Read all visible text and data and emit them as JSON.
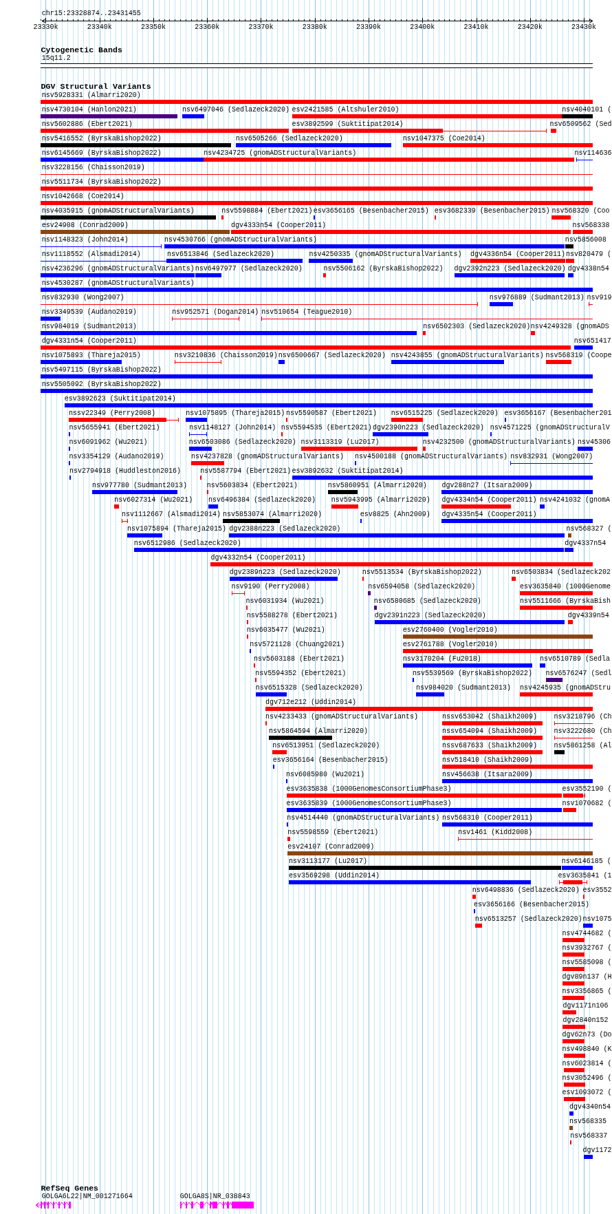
{
  "ruler": {
    "location": "chr15:23328874..23431455",
    "ticks": [
      "23330k",
      "23340k",
      "23350k",
      "23360k",
      "23370k",
      "23380k",
      "23390k",
      "23400k",
      "23410k",
      "23420k",
      "23430k"
    ]
  },
  "cytogenetic_bands": {
    "title": "Cytogenetic Bands",
    "bands": [
      {
        "label": "15q11.2"
      }
    ]
  },
  "dgv_structural_variants": {
    "title": "DGV Structural Variants",
    "lanes": [
      {
        "features": [
          {
            "label": "nsv5928331 (Almarri2020)",
            "color": "#ff0000",
            "kind": "bar"
          }
        ]
      },
      {
        "features": [
          {
            "label": "nsv4730104 (Hanlon2021)",
            "color": "#4b0082",
            "kind": "bar"
          },
          {
            "label": "nsv6497046 (Sedlazeck2020)",
            "color": "#0000ff",
            "kind": "bar"
          },
          {
            "label": "esv2421585 (Altshuler2010)",
            "color": "#ff0000",
            "kind": "bar"
          },
          {
            "label": "nsv4040101 (",
            "color": "#000000",
            "kind": "bar"
          }
        ]
      },
      {
        "features": [
          {
            "label": "nsv5602886 (Ebert2021)",
            "color": "#ff0000",
            "kind": "bar"
          },
          {
            "label": "esv3892599 (Suktitipat2014)",
            "color": "#ff0000",
            "kind": "mixed"
          },
          {
            "label": "nsv6509562 (Sed",
            "color": "#ff0000",
            "kind": "bar"
          }
        ]
      },
      {
        "features": [
          {
            "label": "nsv5416552 (ByrskaBishop2022)",
            "color": "#000000",
            "kind": "bar"
          },
          {
            "label": "nsv6505266 (Sedlazeck2020)",
            "color": "#0000ff",
            "kind": "bar"
          },
          {
            "label": "nsv1047375 (Coe2014)",
            "color": "#ff0000",
            "kind": "bar"
          }
        ]
      },
      {
        "features": [
          {
            "label": "nsv6145669 (ByrskaBishop2022)",
            "color": "#0000ff",
            "kind": "bar"
          },
          {
            "label": "nsv4234725 (gnomADStructuralVariants)",
            "color": "#ff0000",
            "kind": "bar"
          },
          {
            "label": "nsv114636",
            "color": "#0000ff",
            "kind": "line"
          }
        ]
      },
      {
        "features": [
          {
            "label": "nsv3228156 (Chaisson2019)",
            "color": "#ff0000",
            "kind": "line"
          }
        ]
      },
      {
        "features": [
          {
            "label": "nsv5511734 (ByrskaBishop2022)",
            "color": "#ff0000",
            "kind": "bar"
          }
        ]
      },
      {
        "features": [
          {
            "label": "nsv1042668 (Coe2014)",
            "color": "#ff0000",
            "kind": "bar"
          }
        ]
      },
      {
        "features": [
          {
            "label": "nsv4035915 (gnomADStructuralVariants)",
            "color": "#000000",
            "kind": "bar"
          },
          {
            "label": "nsv5598884 (Ebert2021)",
            "color": "#ff0000",
            "kind": "bar"
          },
          {
            "label": "esv3656165 (Besenbacher2015)",
            "color": "#0000ff",
            "kind": "bar"
          },
          {
            "label": "esv3682339 (Besenbacher2015)",
            "color": "#ff0000",
            "kind": "bar"
          },
          {
            "label": "nsv568320 (Coo",
            "color": "#ff0000",
            "kind": "bar"
          }
        ]
      },
      {
        "features": [
          {
            "label": "esv24908 (Conrad2009)",
            "color": "#8b4513",
            "kind": "bar"
          },
          {
            "label": "dgv4333n54 (Cooper2011)",
            "color": "#ff0000",
            "kind": "bar"
          },
          {
            "label": "nsv568338",
            "color": "#ff0000",
            "kind": "bar"
          }
        ]
      },
      {
        "features": [
          {
            "label": "nsv1148323 (John2014)",
            "color": "#0000ff",
            "kind": "line"
          },
          {
            "label": "nsv4530766 (gnomADStructuralVariants)",
            "color": "#0000ff",
            "kind": "bar"
          },
          {
            "label": "nsv5856008",
            "color": "#000000",
            "kind": "bar"
          }
        ]
      },
      {
        "features": [
          {
            "label": "nsv1118552 (Alsmadi2014)",
            "color": "#0000ff",
            "kind": "line"
          },
          {
            "label": "nsv6513846 (Sedlazeck2020)",
            "color": "#0000ff",
            "kind": "bar"
          },
          {
            "label": "nsv4250335 (gnomADStructuralVariants)",
            "color": "#0000ff",
            "kind": "bar"
          },
          {
            "label": "dgv4336n54 (Cooper2011)",
            "color": "#ff0000",
            "kind": "bar"
          },
          {
            "label": "nsv820479 (",
            "color": "#ff0000",
            "kind": "bar"
          }
        ]
      },
      {
        "features": [
          {
            "label": "nsv4236296 (gnomADStructuralVariants)",
            "color": "#0000ff",
            "kind": "bar"
          },
          {
            "label": "nsv6497977 (Sedlazeck2020)",
            "color": "#0000ff",
            "kind": "bar"
          },
          {
            "label": "nsv5506162 (ByrskaBishop2022)",
            "color": "#ff0000",
            "kind": "bar"
          },
          {
            "label": "dgv2392n223 (Sedlazeck2020)",
            "color": "#0000ff",
            "kind": "bar"
          },
          {
            "label": "dgv4338n54",
            "color": "#0000ff",
            "kind": "bar"
          }
        ]
      },
      {
        "features": [
          {
            "label": "nsv4530287 (gnomADStructuralVariants)",
            "color": "#0000ff",
            "kind": "bar"
          }
        ]
      },
      {
        "features": [
          {
            "label": "nsv832930 (Wong2007)",
            "color": "#ff0000",
            "kind": "line"
          },
          {
            "label": "nsv976889 (Sudmant2013)",
            "color": "#0000ff",
            "kind": "bar"
          },
          {
            "label": "nsv919",
            "color": "#ff0000",
            "kind": "line"
          }
        ]
      },
      {
        "features": [
          {
            "label": "nsv3349539 (Audano2019)",
            "color": "#0000ff",
            "kind": "bar"
          },
          {
            "label": "nsv952571 (Dogan2014)",
            "color": "#ff0000",
            "kind": "line"
          },
          {
            "label": "nsv510654 (Teague2010)",
            "color": "#ff0000",
            "kind": "line"
          }
        ]
      },
      {
        "features": [
          {
            "label": "nsv984019 (Sudmant2013)",
            "color": "#0000ff",
            "kind": "bar"
          },
          {
            "label": "nsv6502303 (Sedlazeck2020)",
            "color": "#ff0000",
            "kind": "bar"
          },
          {
            "label": "nsv4249328 (gnomADS",
            "color": "#ff0000",
            "kind": "bar"
          }
        ]
      },
      {
        "features": [
          {
            "label": "dgv4331n54 (Cooper2011)",
            "color": "#ff0000",
            "kind": "bar"
          },
          {
            "label": "nsv651417",
            "color": "#0000ff",
            "kind": "bar"
          }
        ]
      },
      {
        "features": [
          {
            "label": "nsv1075893 (Thareja2015)",
            "color": "#0000ff",
            "kind": "bar"
          },
          {
            "label": "nsv3210836 (Chaisson2019)",
            "color": "#ff0000",
            "kind": "line"
          },
          {
            "label": "nsv6500667 (Sedlazeck2020)",
            "color": "#0000ff",
            "kind": "bar"
          },
          {
            "label": "nsv4243855 (gnomADStructuralVariants)",
            "color": "#0000ff",
            "kind": "bar"
          },
          {
            "label": "nsv568319 (Coope",
            "color": "#ff0000",
            "kind": "bar"
          }
        ]
      },
      {
        "features": [
          {
            "label": "nsv5497115 (ByrskaBishop2022)",
            "color": "#0000ff",
            "kind": "bar"
          }
        ]
      },
      {
        "features": [
          {
            "label": "nsv5505092 (ByrskaBishop2022)",
            "color": "#0000ff",
            "kind": "bar"
          }
        ]
      },
      {
        "features": [
          {
            "label": "esv3892623 (Suktitipat2014)",
            "color": "#0000ff",
            "kind": "bar"
          }
        ]
      },
      {
        "features": [
          {
            "label": "nssv22349 (Perry2008)",
            "color": "#ff0000",
            "kind": "mixed"
          },
          {
            "label": "nsv1075895 (Thareja2015)",
            "color": "#0000ff",
            "kind": "bar"
          },
          {
            "label": "nsv5590587 (Ebert2021)",
            "color": "#ff0000",
            "kind": "bar"
          },
          {
            "label": "nsv6515225 (Sedlazeck2020)",
            "color": "#ff0000",
            "kind": "bar"
          },
          {
            "label": "esv3656167 (Besenbacher201",
            "color": "#0000ff",
            "kind": "bar"
          }
        ]
      },
      {
        "features": [
          {
            "label": "nsv5655941 (Ebert2021)",
            "color": "#0000ff",
            "kind": "bar"
          },
          {
            "label": "nsv1148127 (John2014)",
            "color": "#0000ff",
            "kind": "line"
          },
          {
            "label": "nsv5594535 (Ebert2021)",
            "color": "#ff0000",
            "kind": "bar"
          },
          {
            "label": "dgv2390n223 (Sedlazeck2020)",
            "color": "#0000ff",
            "kind": "bar"
          },
          {
            "label": "nsv4571225 (gnomADStructuralV",
            "color": "#0000ff",
            "kind": "bar"
          }
        ]
      },
      {
        "features": [
          {
            "label": "nsv6091962 (Wu2021)",
            "color": "#0000ff",
            "kind": "bar"
          },
          {
            "label": "nsv6503086 (Sedlazeck2020)",
            "color": "#0000ff",
            "kind": "bar"
          },
          {
            "label": "nsv3113319 (Lu2017)",
            "color": "#ff0000",
            "kind": "bar"
          },
          {
            "label": "nsv4232500 (gnomADStructuralVariants)",
            "color": "#ff0000",
            "kind": "bar"
          },
          {
            "label": "nsv45306",
            "color": "#0000ff",
            "kind": "bar"
          }
        ]
      },
      {
        "features": [
          {
            "label": "nsv3354129 (Audano2019)",
            "color": "#0000ff",
            "kind": "bar"
          },
          {
            "label": "nsv4237828 (gnomADStructuralVariants)",
            "color": "#ff0000",
            "kind": "bar"
          },
          {
            "label": "nsv4500188 (gnomADStructuralVariants)",
            "color": "#0000ff",
            "kind": "bar"
          },
          {
            "label": "nsv832931 (Wong2007)",
            "color": "#0000ff",
            "kind": "line"
          }
        ]
      },
      {
        "features": [
          {
            "label": "nsv2794918 (Huddleston2016)",
            "color": "#0000ff",
            "kind": "bar"
          },
          {
            "label": "nsv5587794 (Ebert2021)",
            "color": "#ff0000",
            "kind": "bar"
          },
          {
            "label": "esv3892632 (Suktitipat2014)",
            "color": "#0000ff",
            "kind": "bar"
          }
        ]
      },
      {
        "features": [
          {
            "label": "nsv977780 (Sudmant2013)",
            "color": "#0000ff",
            "kind": "bar"
          },
          {
            "label": "nsv5603834 (Ebert2021)",
            "color": "#ff0000",
            "kind": "bar"
          },
          {
            "label": "nsv5860951 (Almarri2020)",
            "color": "#000000",
            "kind": "bar"
          },
          {
            "label": "dgv288n27 (Itsara2009)",
            "color": "#0000ff",
            "kind": "bar"
          }
        ]
      },
      {
        "features": [
          {
            "label": "nsv6027314 (Wu2021)",
            "color": "#ff0000",
            "kind": "bar"
          },
          {
            "label": "nsv6496384 (Sedlazeck2020)",
            "color": "#0000ff",
            "kind": "bar"
          },
          {
            "label": "nsv5943995 (Almarri2020)",
            "color": "#ff0000",
            "kind": "bar"
          },
          {
            "label": "dgv4334n54 (Cooper2011)",
            "color": "#ff0000",
            "kind": "bar"
          },
          {
            "label": "nsv4241032 (gnomA",
            "color": "#0000ff",
            "kind": "bar"
          }
        ]
      },
      {
        "features": [
          {
            "label": "nsv1112667 (Alsmadi2014)",
            "color": "#ff0000",
            "kind": "line"
          },
          {
            "label": "nsv5853074 (Almarri2020)",
            "color": "#000000",
            "kind": "bar"
          },
          {
            "label": "esv8825 (Ahn2009)",
            "color": "#0000ff",
            "kind": "bar"
          },
          {
            "label": "dgv4335n54 (Cooper2011)",
            "color": "#0000ff",
            "kind": "bar"
          }
        ]
      },
      {
        "features": [
          {
            "label": "nsv1075894 (Thareja2015)",
            "color": "#0000ff",
            "kind": "bar"
          },
          {
            "label": "dgv2388n223 (Sedlazeck2020)",
            "color": "#0000ff",
            "kind": "bar"
          },
          {
            "label": "nsv568327 (",
            "color": "#8b4513",
            "kind": "bar"
          }
        ]
      },
      {
        "features": [
          {
            "label": "nsv6512986 (Sedlazeck2020)",
            "color": "#0000ff",
            "kind": "bar"
          },
          {
            "label": "dgv4337n54",
            "color": "#0000ff",
            "kind": "bar"
          }
        ]
      },
      {
        "features": [
          {
            "label": "dgv4332n54 (Cooper2011)",
            "color": "#ff0000",
            "kind": "bar"
          }
        ]
      },
      {
        "features": [
          {
            "label": "dgv2389n223 (Sedlazeck2020)",
            "color": "#0000ff",
            "kind": "bar"
          },
          {
            "label": "nsv5513534 (ByrskaBishop2022)",
            "color": "#ff0000",
            "kind": "bar"
          },
          {
            "label": "nsv6503834 (Sedlazeck202",
            "color": "#ff0000",
            "kind": "bar"
          }
        ]
      },
      {
        "features": [
          {
            "label": "nsv9190 (Perry2008)",
            "color": "#ff0000",
            "kind": "line"
          },
          {
            "label": "nsv6594058 (Sedlazeck2020)",
            "color": "#4b0082",
            "kind": "bar"
          },
          {
            "label": "esv3635840 (1000Genome",
            "color": "#ff0000",
            "kind": "bar"
          }
        ]
      },
      {
        "features": [
          {
            "label": "nsv6031934 (Wu2021)",
            "color": "#ff0000",
            "kind": "bar"
          },
          {
            "label": "nsv6580685 (Sedlazeck2020)",
            "color": "#4b0082",
            "kind": "bar"
          },
          {
            "label": "nsv5511666 (ByrskaBish",
            "color": "#ff0000",
            "kind": "bar"
          }
        ]
      },
      {
        "features": [
          {
            "label": "nsv5588278 (Ebert2021)",
            "color": "#ff0000",
            "kind": "bar"
          },
          {
            "label": "dgv2391n223 (Sedlazeck2020)",
            "color": "#0000ff",
            "kind": "bar"
          },
          {
            "label": "dgv4339n54",
            "color": "#ff0000",
            "kind": "bar"
          }
        ]
      },
      {
        "features": [
          {
            "label": "nsv6035477 (Wu2021)",
            "color": "#ff0000",
            "kind": "bar"
          },
          {
            "label": "esv2760400 (Vogler2010)",
            "color": "#8b4513",
            "kind": "bar"
          }
        ]
      },
      {
        "features": [
          {
            "label": "nsv5721128 (Chuang2021)",
            "color": "#0000ff",
            "kind": "bar"
          },
          {
            "label": "esv2761788 (Vogler2010)",
            "color": "#ff0000",
            "kind": "bar"
          }
        ]
      },
      {
        "features": [
          {
            "label": "nsv5603188 (Ebert2021)",
            "color": "#ff0000",
            "kind": "bar"
          },
          {
            "label": "nsv3170204 (Fu2018)",
            "color": "#0000ff",
            "kind": "bar"
          },
          {
            "label": "nsv6510789 (Sedla",
            "color": "#0000ff",
            "kind": "bar"
          }
        ]
      },
      {
        "features": [
          {
            "label": "nsv5594352 (Ebert2021)",
            "color": "#ff0000",
            "kind": "bar"
          },
          {
            "label": "nsv5539569 (ByrskaBishop2022)",
            "color": "#0000ff",
            "kind": "bar"
          },
          {
            "label": "nsv6576247 (Sedl",
            "color": "#4b0082",
            "kind": "bar"
          }
        ]
      },
      {
        "features": [
          {
            "label": "nsv6515328 (Sedlazeck2020)",
            "color": "#0000ff",
            "kind": "bar"
          },
          {
            "label": "nsv984020 (Sudmant2013)",
            "color": "#0000ff",
            "kind": "bar"
          },
          {
            "label": "nsv4245935 (gnomADStru",
            "color": "#ff0000",
            "kind": "bar"
          }
        ]
      },
      {
        "features": [
          {
            "label": "dgv712e212 (Uddin2014)",
            "color": "#ff0000",
            "kind": "bar"
          }
        ]
      },
      {
        "features": [
          {
            "label": "nsv4233433 (gnomADStructuralVariants)",
            "color": "#ff0000",
            "kind": "bar"
          },
          {
            "label": "nssv653042 (Shaikh2009)",
            "color": "#ff0000",
            "kind": "bar"
          },
          {
            "label": "nsv3218796 (Ch",
            "color": "#ff0000",
            "kind": "line"
          }
        ]
      },
      {
        "features": [
          {
            "label": "nsv5864594 (Almarri2020)",
            "color": "#000000",
            "kind": "bar"
          },
          {
            "label": "nssv654094 (Shaikh2009)",
            "color": "#ff0000",
            "kind": "bar"
          },
          {
            "label": "nsv3222680 (Ch",
            "color": "#ff0000",
            "kind": "line"
          }
        ]
      },
      {
        "features": [
          {
            "label": "nsv6513951 (Sedlazeck2020)",
            "color": "#ff0000",
            "kind": "bar"
          },
          {
            "label": "nssv687633 (Shaikh2009)",
            "color": "#ff0000",
            "kind": "bar"
          },
          {
            "label": "nsv5861258 (Al",
            "color": "#000000",
            "kind": "bar"
          }
        ]
      },
      {
        "features": [
          {
            "label": "esv3656164 (Besenbacher2015)",
            "color": "#0000ff",
            "kind": "bar"
          },
          {
            "label": "nsv518410 (Shaikh2009)",
            "color": "#ff0000",
            "kind": "bar"
          }
        ]
      },
      {
        "features": [
          {
            "label": "nsv6085980 (Wu2021)",
            "color": "#0000ff",
            "kind": "bar"
          },
          {
            "label": "nsv456638 (Itsara2009)",
            "color": "#0000ff",
            "kind": "bar"
          }
        ]
      },
      {
        "features": [
          {
            "label": "esv3635838 (1000GenomesConsortiumPhase3)",
            "color": "#ff0000",
            "kind": "bar"
          },
          {
            "label": "esv3552190 (",
            "color": "#ff0000",
            "kind": "mixed"
          }
        ]
      },
      {
        "features": [
          {
            "label": "esv3635839 (1000GenomesConsortiumPhase3)",
            "color": "#0000ff",
            "kind": "bar"
          },
          {
            "label": "nsv1070682 (",
            "color": "#ff0000",
            "kind": "bar"
          }
        ]
      },
      {
        "features": [
          {
            "label": "nsv4514440 (gnomADStructuralVariants)",
            "color": "#0000ff",
            "kind": "bar"
          },
          {
            "label": "nsv568310 (Cooper2011)",
            "color": "#0000ff",
            "kind": "bar"
          }
        ]
      },
      {
        "features": [
          {
            "label": "nsv5598559 (Ebert2021)",
            "color": "#ff0000",
            "kind": "bar"
          },
          {
            "label": "nsv1461 (Kidd2008)",
            "color": "#ff0000",
            "kind": "line"
          }
        ]
      },
      {
        "features": [
          {
            "label": "esv24107 (Conrad2009)",
            "color": "#8b4513",
            "kind": "bar"
          }
        ]
      },
      {
        "features": [
          {
            "label": "nsv3113177 (Lu2017)",
            "color": "#000000",
            "kind": "bar"
          },
          {
            "label": "nsv6146185 (",
            "color": "#0000ff",
            "kind": "bar"
          }
        ]
      },
      {
        "features": [
          {
            "label": "esv3569298 (Uddin2014)",
            "color": "#0000ff",
            "kind": "bar"
          },
          {
            "label": "esv3635841 (1",
            "color": "#ff0000",
            "kind": "mixed"
          }
        ]
      },
      {
        "features": [
          {
            "label": "nsv6498836 (Sedlazeck2020)",
            "color": "#ff0000",
            "kind": "bar"
          },
          {
            "label": "esv3552",
            "color": "#ff0000",
            "kind": "bar"
          }
        ]
      },
      {
        "features": [
          {
            "label": "esv3656166 (Besenbacher2015)",
            "color": "#0000ff",
            "kind": "bar"
          }
        ]
      },
      {
        "features": [
          {
            "label": "nsv6513257 (Sedlazeck2020)",
            "color": "#ff0000",
            "kind": "bar"
          },
          {
            "label": "nsv1075",
            "color": "#0000ff",
            "kind": "bar"
          }
        ]
      },
      {
        "features": [
          {
            "label": "nsv4744682 (",
            "color": "#ff0000",
            "kind": "bar"
          }
        ]
      },
      {
        "features": [
          {
            "label": "nsv3932767 (",
            "color": "#ff0000",
            "kind": "bar"
          }
        ]
      },
      {
        "features": [
          {
            "label": "nsv5585098 (",
            "color": "#ff0000",
            "kind": "bar"
          }
        ]
      },
      {
        "features": [
          {
            "label": "dgv89n137 (H",
            "color": "#ff0000",
            "kind": "bar"
          }
        ]
      },
      {
        "features": [
          {
            "label": "nsv3356865 (",
            "color": "#ff0000",
            "kind": "bar"
          }
        ]
      },
      {
        "features": [
          {
            "label": "dgv1171n106",
            "color": "#ff0000",
            "kind": "bar"
          }
        ]
      },
      {
        "features": [
          {
            "label": "dgv2840n152",
            "color": "#ff0000",
            "kind": "bar"
          }
        ]
      },
      {
        "features": [
          {
            "label": "dgv62n73 (Do",
            "color": "#ff0000",
            "kind": "bar"
          }
        ]
      },
      {
        "features": [
          {
            "label": "nsv498840 (K",
            "color": "#ff0000",
            "kind": "bar"
          }
        ]
      },
      {
        "features": [
          {
            "label": "nsv6023814 (",
            "color": "#ff0000",
            "kind": "bar"
          }
        ]
      },
      {
        "features": [
          {
            "label": "nsv3052496 (",
            "color": "#ff0000",
            "kind": "bar"
          }
        ]
      },
      {
        "features": [
          {
            "label": "esv1093072 (",
            "color": "#ff0000",
            "kind": "bar"
          }
        ]
      },
      {
        "features": [
          {
            "label": "dgv4340n54",
            "color": "#0000ff",
            "kind": "bar"
          }
        ]
      },
      {
        "features": [
          {
            "label": "nsv568335",
            "color": "#8b4513",
            "kind": "bar"
          }
        ]
      },
      {
        "features": [
          {
            "label": "nsv568337",
            "color": "#ff0000",
            "kind": "bar"
          }
        ]
      },
      {
        "features": [
          {
            "label": "dgv1172",
            "color": "#0000ff",
            "kind": "bar"
          }
        ]
      }
    ]
  },
  "refseq_genes": {
    "title": "RefSeq Genes",
    "genes": [
      {
        "label": "GOLGA6L22|NM_001271664"
      },
      {
        "label": "GOLGA8S|NR_038843"
      }
    ]
  }
}
